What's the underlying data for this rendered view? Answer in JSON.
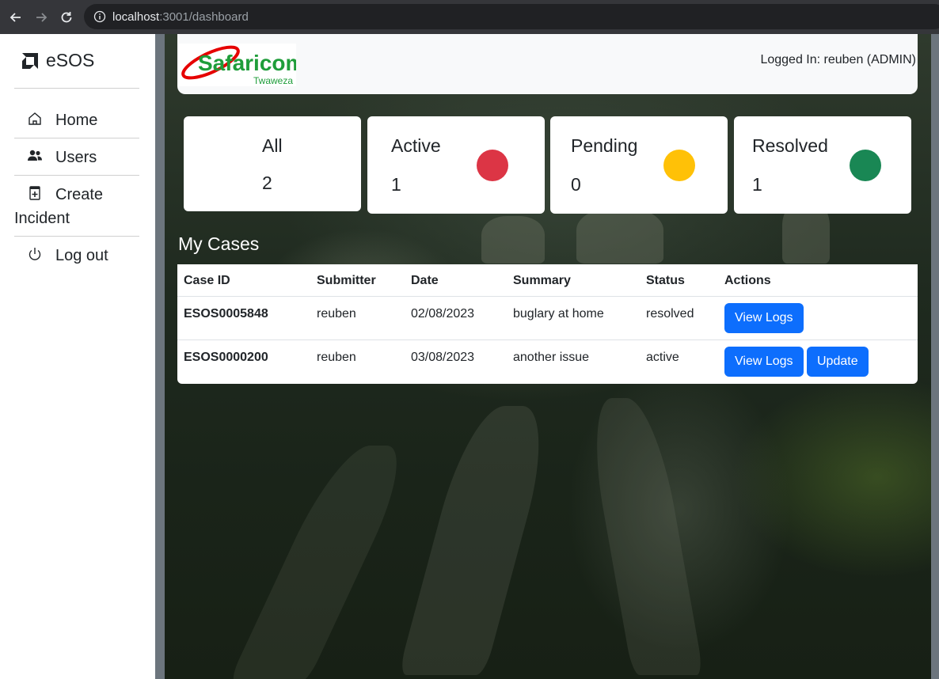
{
  "browser": {
    "url_host": "localhost",
    "url_path": ":3001/dashboard"
  },
  "sidebar": {
    "brand": "eSOS",
    "items": [
      {
        "label": "Home",
        "icon": "house-icon"
      },
      {
        "label": "Users",
        "icon": "people-icon"
      },
      {
        "label": "Create",
        "label2": "Incident",
        "icon": "file-plus-icon"
      },
      {
        "label": "Log out",
        "icon": "power-icon"
      }
    ]
  },
  "header": {
    "logo_text": "Safaricom",
    "logo_sub": "Twaweza",
    "logged_in": "Logged In:  reuben (ADMIN)"
  },
  "stats": [
    {
      "title": "All",
      "count": "2"
    },
    {
      "title": "Active",
      "count": "1",
      "color": "#dc3545"
    },
    {
      "title": "Pending",
      "count": "0",
      "color": "#ffc107"
    },
    {
      "title": "Resolved",
      "count": "1",
      "color": "#198754"
    }
  ],
  "cases": {
    "title": "My Cases",
    "columns": [
      "Case ID",
      "Submitter",
      "Date",
      "Summary",
      "Status",
      "Actions"
    ],
    "rows": [
      {
        "id": "ESOS0005848",
        "submitter": "reuben",
        "date": "02/08/2023",
        "summary": "buglary at home",
        "status": "resolved",
        "actions": [
          "View Logs"
        ]
      },
      {
        "id": "ESOS0000200",
        "submitter": "reuben",
        "date": "03/08/2023",
        "summary": "another issue",
        "status": "active",
        "actions": [
          "View Logs",
          "Update"
        ]
      }
    ]
  },
  "colors": {
    "primary": "#0d6efd",
    "active": "#dc3545",
    "pending": "#ffc107",
    "resolved": "#198754",
    "safaricom_red": "#e60000",
    "safaricom_green": "#1f9d3a"
  }
}
